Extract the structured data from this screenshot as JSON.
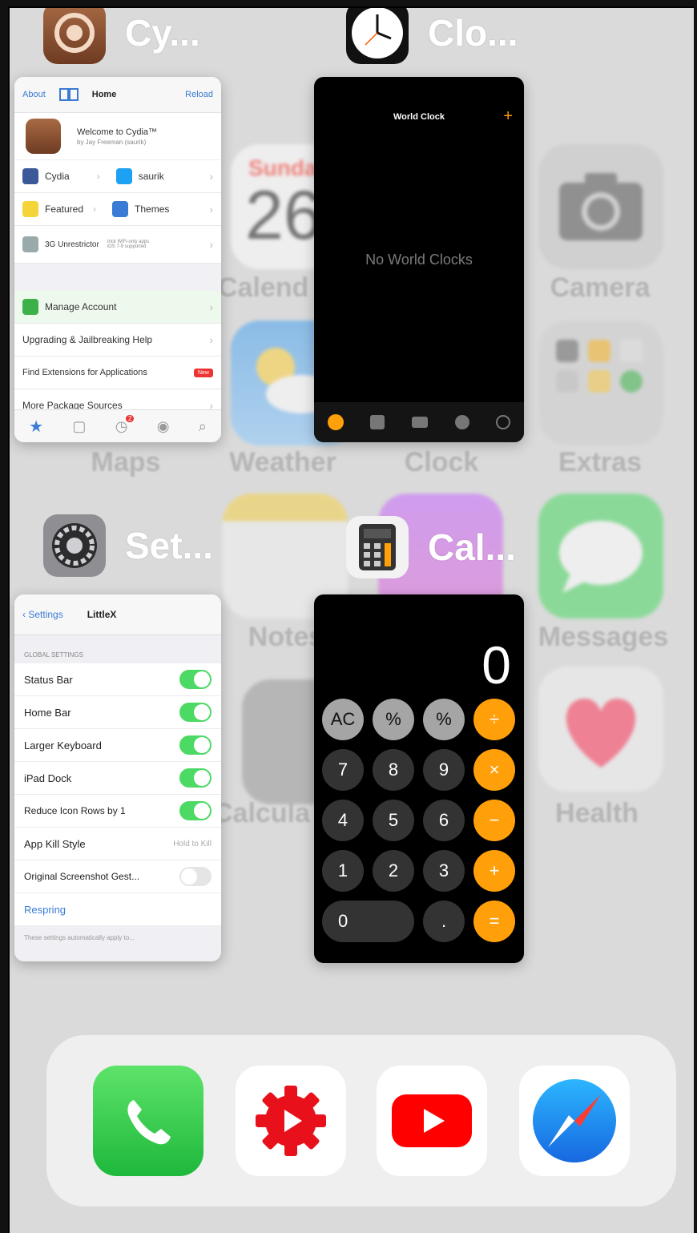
{
  "background_apps": [
    {
      "label": "Calend"
    },
    {
      "label": "Camera"
    },
    {
      "label": "Maps"
    },
    {
      "label": "Weather"
    },
    {
      "label": "Clock"
    },
    {
      "label": "Extras"
    },
    {
      "label": "Notes"
    },
    {
      "label": "Messages"
    },
    {
      "label": "Calcula"
    },
    {
      "label": "Health"
    }
  ],
  "calendar_bg": {
    "day": "Sunda",
    "date": "26"
  },
  "switcher": {
    "cydia": {
      "name": "Cy...",
      "nav_left": "About",
      "nav_title": "Home",
      "nav_right": "Reload",
      "welcome": "Welcome to Cydia™",
      "byline": "by Jay Freeman (saurik)",
      "rows": [
        {
          "left": "Cydia",
          "right": "saurik"
        },
        {
          "left": "Featured",
          "right": "Themes"
        }
      ],
      "unrestrictor": "3G Unrestrictor",
      "unrestrictor_note": "trick WiFi-only apps  iOS 7-9 supported",
      "manage": "Manage Account",
      "links": [
        "Upgrading & Jailbreaking Help",
        "Find Extensions for Applications",
        "More Package Sources"
      ],
      "new_badge": "New",
      "tab_badge": "2"
    },
    "clock": {
      "name": "Clo...",
      "title": "World Clock",
      "add": "+",
      "empty": "No World Clocks"
    },
    "settings": {
      "name": "Set...",
      "back": "Settings",
      "title": "LittleX",
      "section": "GLOBAL SETTINGS",
      "rows": [
        {
          "label": "Status Bar"
        },
        {
          "label": "Home Bar"
        },
        {
          "label": "Larger Keyboard"
        },
        {
          "label": "iPad Dock"
        },
        {
          "label": "Reduce Icon Rows by 1"
        }
      ],
      "kill_label": "App Kill Style",
      "kill_value": "Hold to Kill",
      "screenshot_label": "Original Screenshot Gest...",
      "respring": "Respring",
      "footer": "These settings automatically apply to..."
    },
    "calculator": {
      "name": "Cal...",
      "display": "0",
      "keys": [
        "AC",
        "%",
        "%",
        "÷",
        "7",
        "8",
        "9",
        "×",
        "4",
        "5",
        "6",
        "−",
        "1",
        "2",
        "3",
        "+",
        "0",
        ".",
        "="
      ]
    }
  },
  "colors": {
    "accent_orange": "#ff9f0a",
    "toggle_green": "#4cd964",
    "cydia_blue": "#3a7bd5"
  },
  "dock": [
    {
      "icon": "phone-icon"
    },
    {
      "icon": "gear-play-icon"
    },
    {
      "icon": "youtube-icon"
    },
    {
      "icon": "safari-icon"
    }
  ]
}
